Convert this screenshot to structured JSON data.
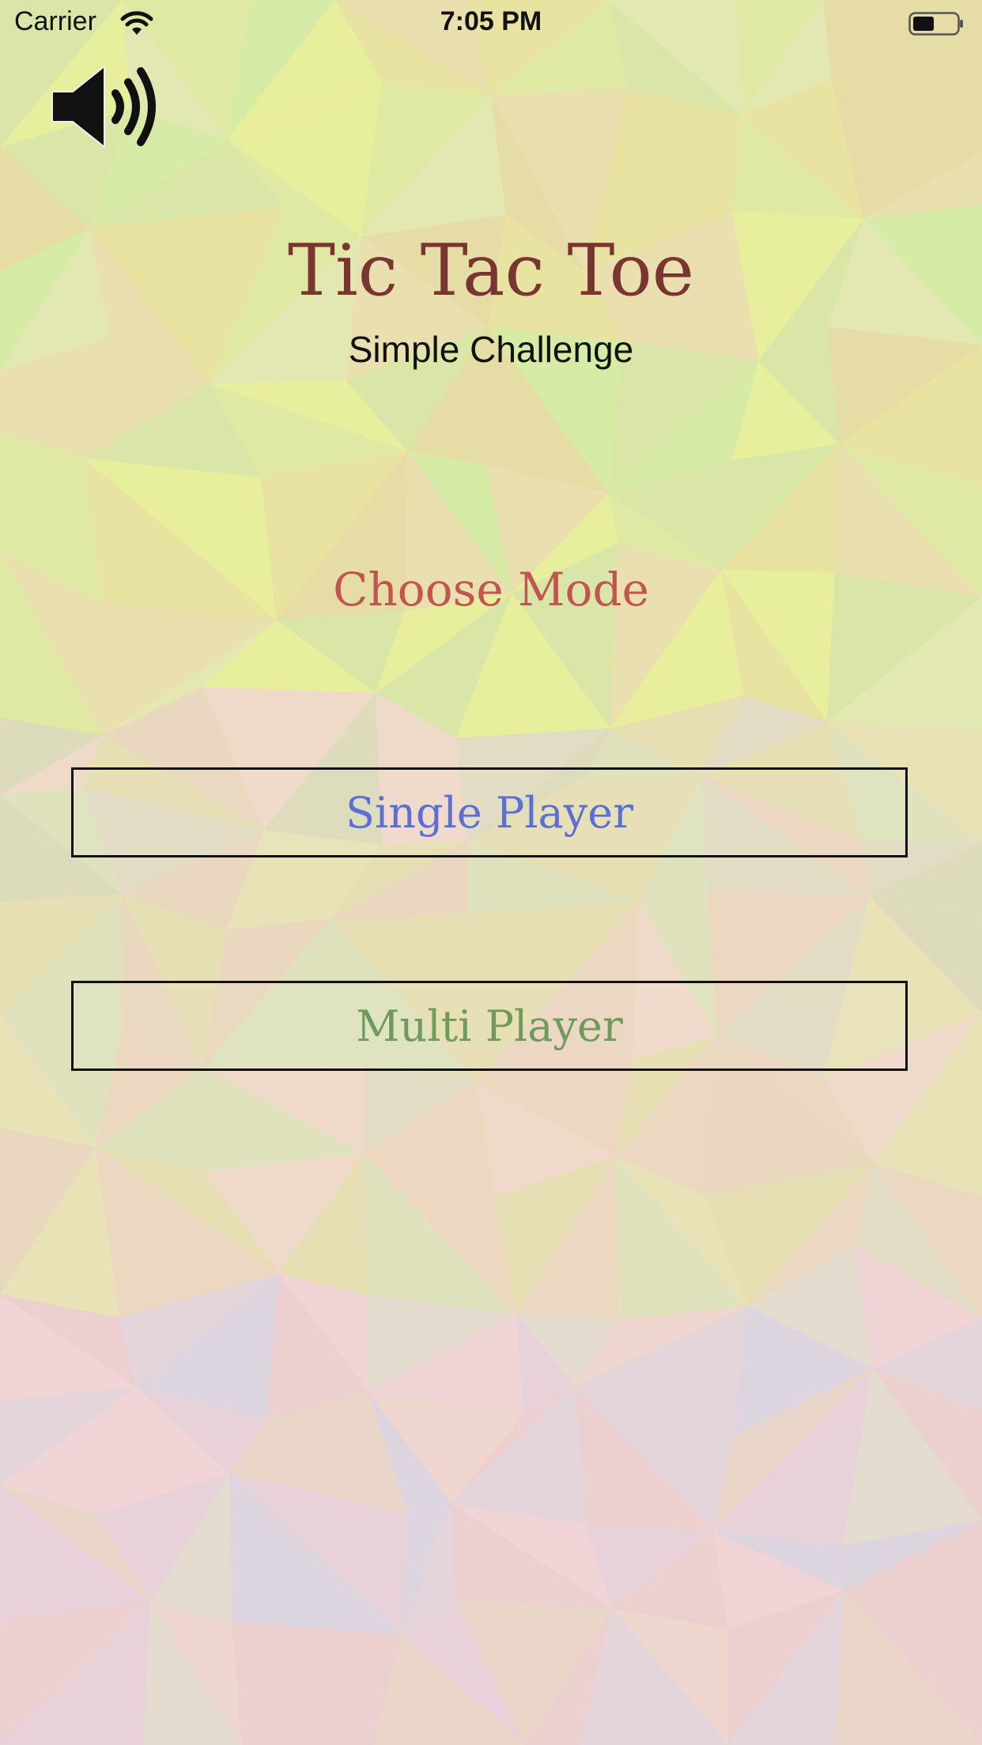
{
  "status_bar": {
    "carrier": "Carrier",
    "time": "7:05 PM",
    "wifi_icon": "wifi-icon",
    "battery_icon": "battery-icon"
  },
  "sound": {
    "icon": "speaker-volume-icon"
  },
  "header": {
    "title": "Tic Tac Toe",
    "subtitle": "Simple Challenge"
  },
  "mode": {
    "prompt": "Choose Mode",
    "single_label": "Single Player",
    "multi_label": "Multi Player"
  },
  "colors": {
    "title": "#7a3530",
    "prompt": "#c25550",
    "single": "#5b6fd6",
    "multi": "#6f9a5e",
    "border": "#111111"
  }
}
